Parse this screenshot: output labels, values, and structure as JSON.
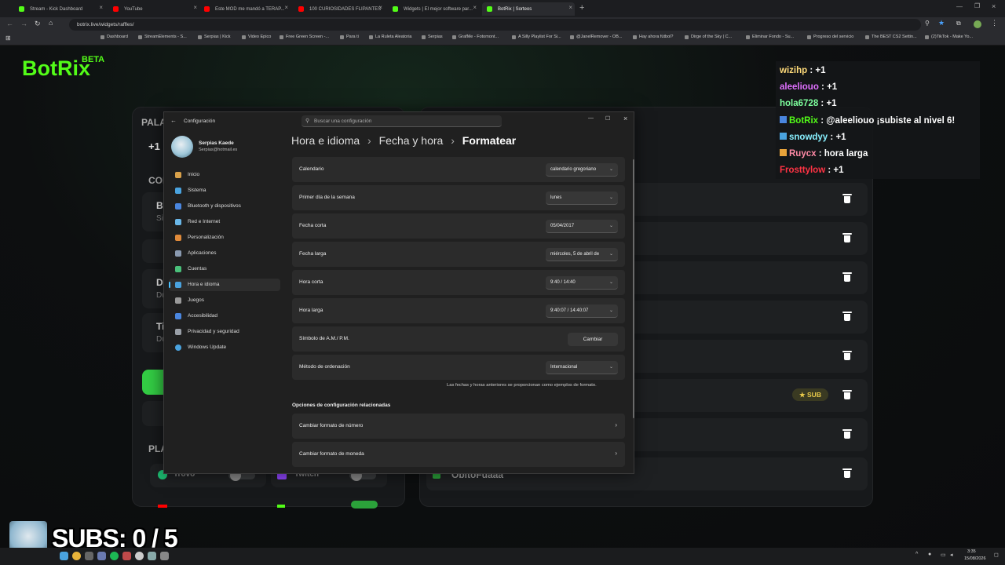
{
  "browser": {
    "tabs": [
      {
        "label": "Stream - Kick Dashboard",
        "color": "#53fc18",
        "active": false
      },
      {
        "label": "YouTube",
        "color": "#ff0000",
        "active": false
      },
      {
        "label": "Este MOD me mandó a TERAP...",
        "color": "#ff0000",
        "active": false
      },
      {
        "label": "100 CURIOSIDADES FLIPANTES",
        "color": "#ff0000",
        "active": false
      },
      {
        "label": "Widgets | El mejor software par...",
        "color": "#53fc18",
        "active": false
      },
      {
        "label": "BotRix | Sorteos",
        "color": "#53fc18",
        "active": true
      }
    ],
    "url": "botrix.live/widgets/raffles/",
    "bookmarks": [
      "Dashboard",
      "StreamElements - S...",
      "Serpias | Kick",
      "Video Epico",
      "Free Green Screen -...",
      "Para ti",
      "La Ruleta Aleatoria",
      "Serpias",
      "GrafMe - Fotomont...",
      "A Silly Playlist For Si...",
      "@JanelRemover - OB...",
      "Hay ahora fútbol?",
      "Dirge of the Sky | C...",
      "Eliminar Fondo - Su...",
      "Progreso del servicio",
      "The BEST CS2 Settin...",
      "(2)TikTok - Make Yo..."
    ]
  },
  "botrix": {
    "logo": "BotRix",
    "beta": "BETA",
    "left_panel": {
      "title_fragment": "PALA",
      "plus_one": "+1",
      "con": "CON",
      "b_item": "B",
      "s_item": "Si",
      "d1": "Di",
      "d2": "Du",
      "t1": "Ti",
      "t2": "Du",
      "platforms_label": "PLA",
      "trovo": "Trovo",
      "twitch": "Twitch",
      "youtube": "YouTube",
      "kick": "Kick"
    },
    "right_panel": {
      "sub_badge": "SUB",
      "last_user": "ObitoFuaaa"
    },
    "subs_counter": "SUBS: 0 / 5"
  },
  "chat": [
    {
      "user": "wizihp",
      "text": " : +1",
      "color": "#ffdb7a"
    },
    {
      "user": "aleeliouo",
      "text": " : +1",
      "color": "#e070ff"
    },
    {
      "user": "hola6728",
      "text": " : +1",
      "color": "#7dff9d"
    },
    {
      "user": "BotRix",
      "text": " : @aleeliouo ¡subiste al nivel 6!",
      "color": "#53fc18"
    },
    {
      "user": "snowdyy",
      "text": " : +1",
      "color": "#88f0ff"
    },
    {
      "user": "Ruycx",
      "text": " : hora larga",
      "color": "#ff8aa6"
    },
    {
      "user": "Frosttylow",
      "text": " : +1",
      "color": "#ff3344"
    }
  ],
  "settings": {
    "title": "Configuración",
    "search_placeholder": "Buscar una configuración",
    "user_name": "Serpias Kaede",
    "user_email": "Serpias@hotmail.es",
    "breadcrumb": [
      "Hora e idioma",
      "Fecha y hora",
      "Formatear"
    ],
    "nav": [
      {
        "label": "Inicio",
        "color": "#d9a14a",
        "active": false
      },
      {
        "label": "Sistema",
        "color": "#4aa3df",
        "active": false
      },
      {
        "label": "Bluetooth y dispositivos",
        "color": "#4a86df",
        "active": false
      },
      {
        "label": "Red e Internet",
        "color": "#6ab7e8",
        "active": false
      },
      {
        "label": "Personalización",
        "color": "#e08a3a",
        "active": false
      },
      {
        "label": "Aplicaciones",
        "color": "#8a9ab0",
        "active": false
      },
      {
        "label": "Cuentas",
        "color": "#4ac07a",
        "active": false
      },
      {
        "label": "Hora e idioma",
        "color": "#4aa3df",
        "active": true
      },
      {
        "label": "Juegos",
        "color": "#9a9a9a",
        "active": false
      },
      {
        "label": "Accesibilidad",
        "color": "#4a86df",
        "active": false
      },
      {
        "label": "Privacidad y seguridad",
        "color": "#9aa0a8",
        "active": false
      },
      {
        "label": "Windows Update",
        "color": "#4aa3df",
        "active": false
      }
    ],
    "rows": [
      {
        "label": "Calendario",
        "value": "calendario gregoriano",
        "type": "dropdown"
      },
      {
        "label": "Primer día de la semana",
        "value": "lunes",
        "type": "dropdown"
      },
      {
        "label": "Fecha corta",
        "value": "05/04/2017",
        "type": "dropdown"
      },
      {
        "label": "Fecha larga",
        "value": "miércoles, 5 de abril de",
        "type": "dropdown"
      },
      {
        "label": "Hora corta",
        "value": "9:40 / 14:40",
        "type": "dropdown"
      },
      {
        "label": "Hora larga",
        "value": "9:40:07 / 14:40:07",
        "type": "dropdown"
      },
      {
        "label": "Símbolo de A.M./ P.M.",
        "value": "Cambiar",
        "type": "button"
      },
      {
        "label": "Método de ordenación",
        "value": "Internacional",
        "type": "dropdown"
      }
    ],
    "note": "Las fechas y horas anteriores se proporcionan como ejemplos de formato.",
    "related_title": "Opciones de configuración relacionadas",
    "related": [
      "Cambiar formato de número",
      "Cambiar formato de moneda"
    ]
  },
  "taskbar": {
    "time": "3:35",
    "date": "15/08/2026"
  }
}
